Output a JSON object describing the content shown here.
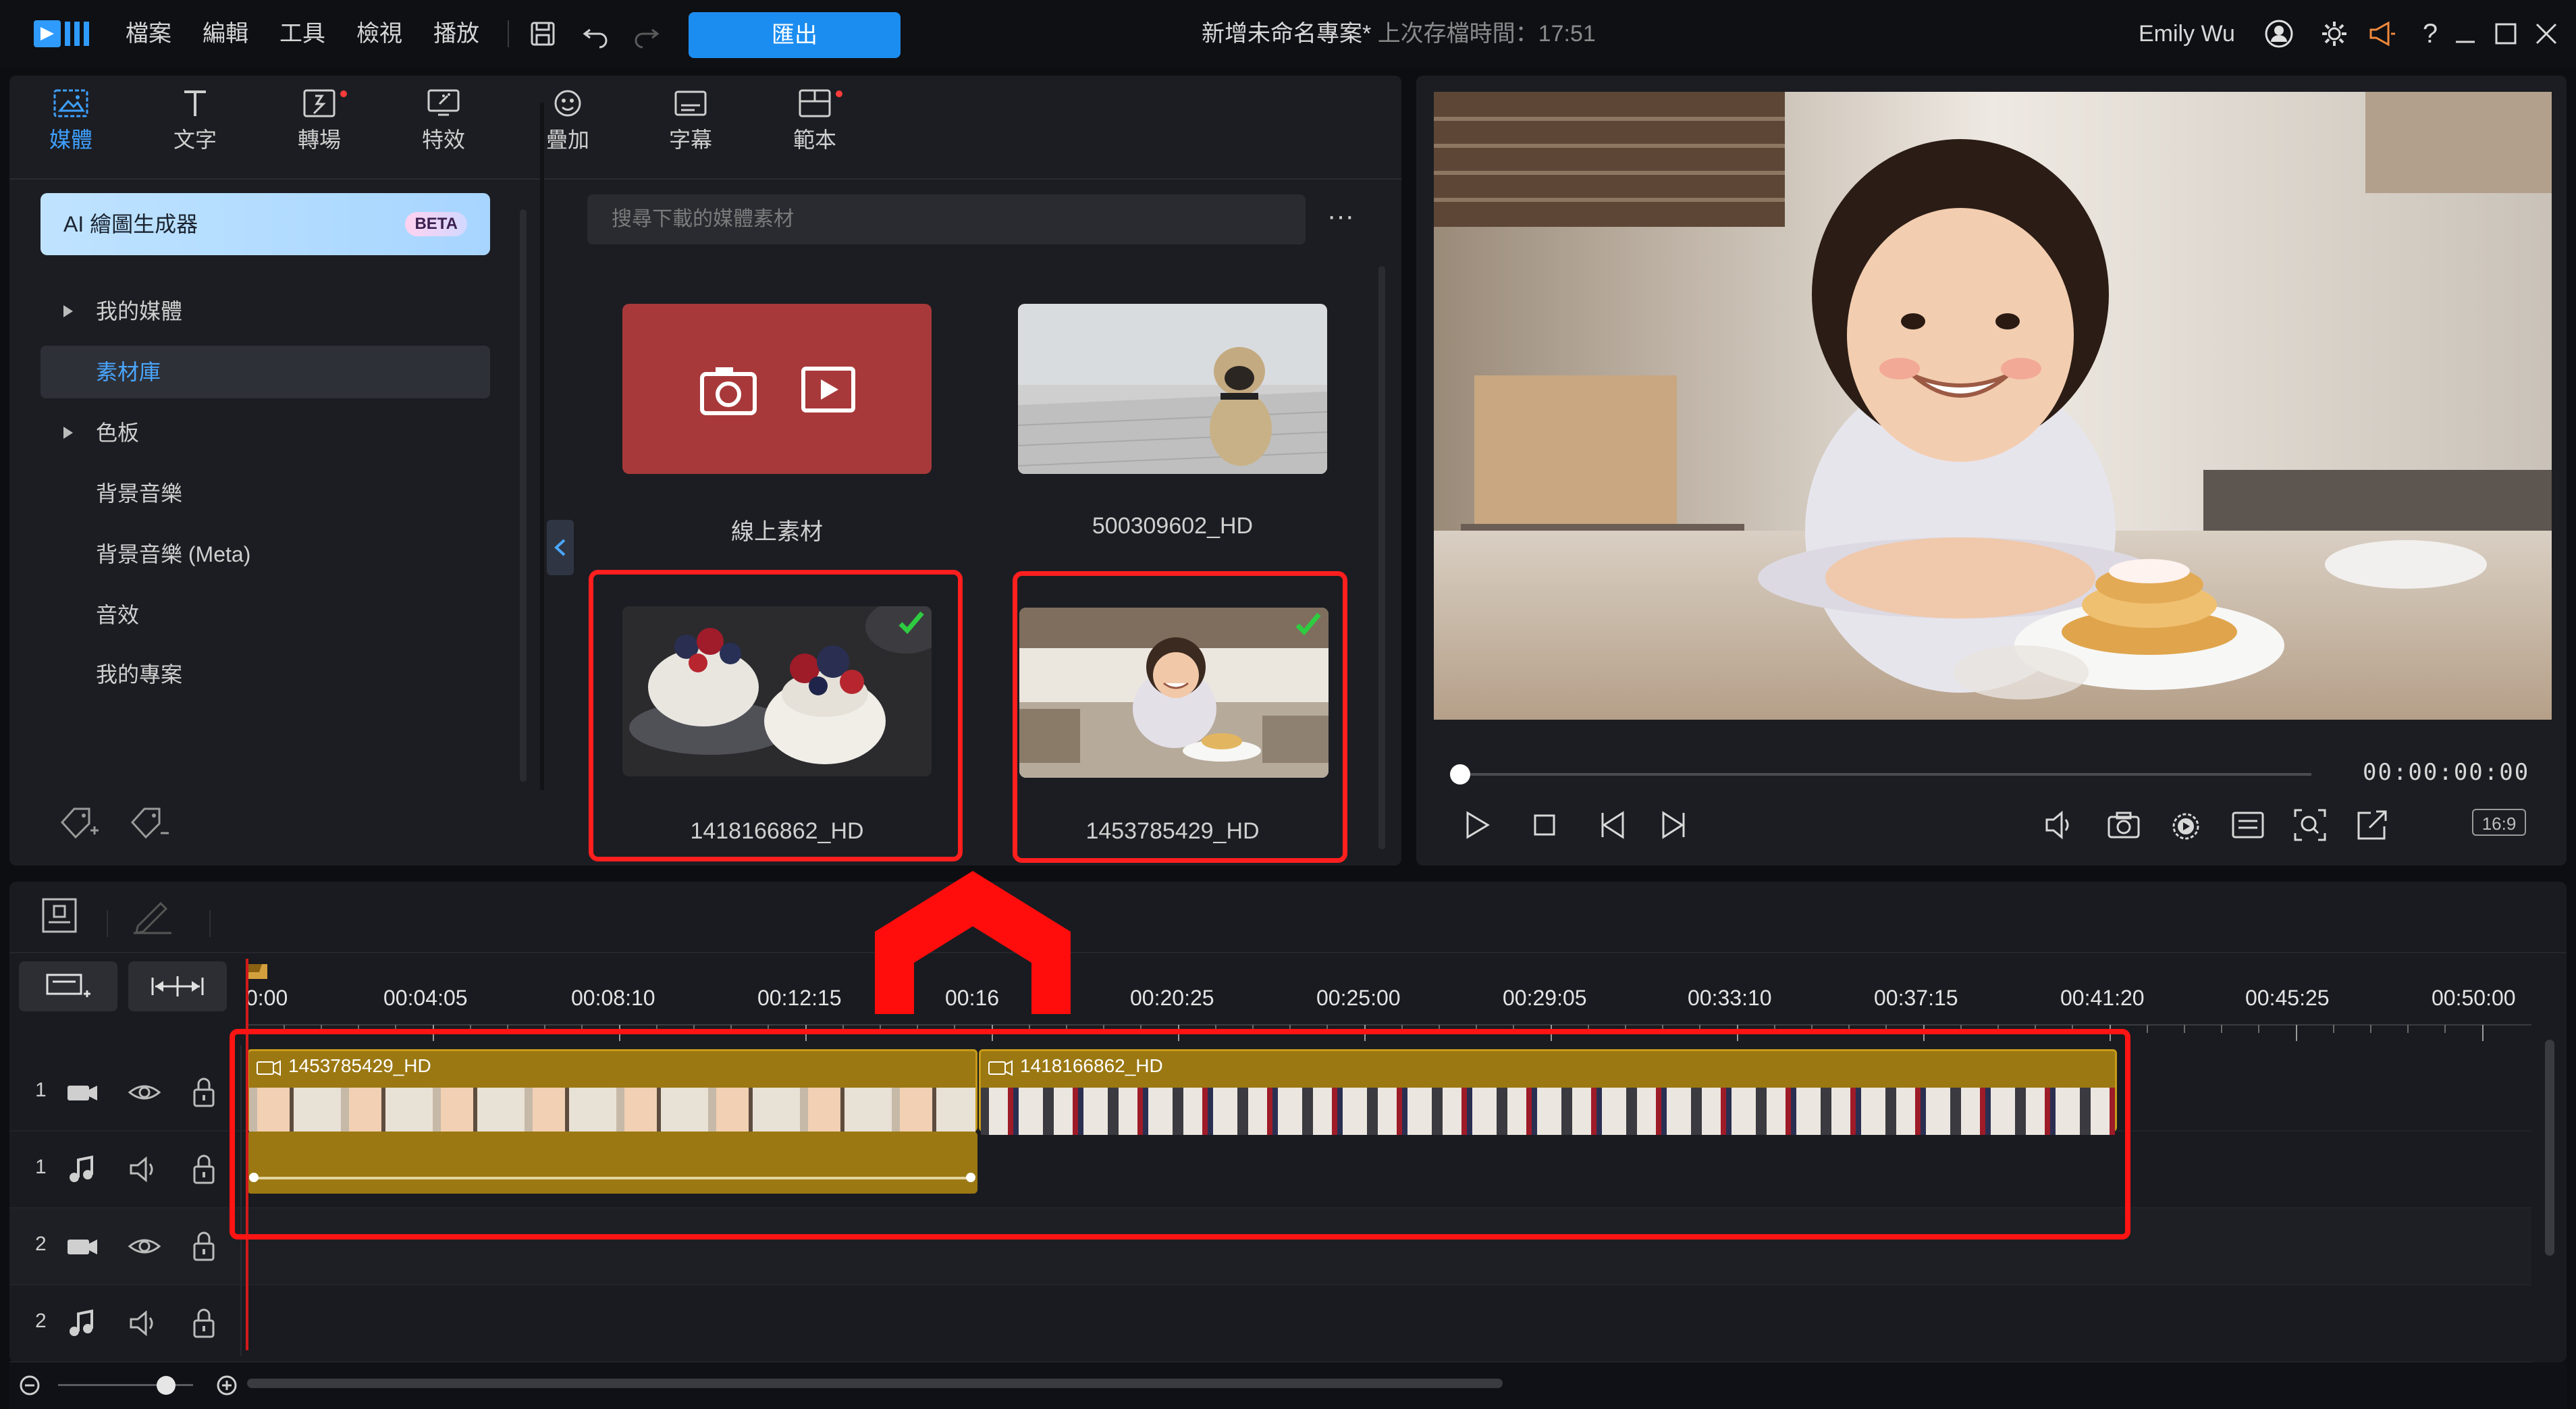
{
  "titlebar": {
    "menu": [
      "檔案",
      "編輯",
      "工具",
      "檢視",
      "播放"
    ],
    "export_label": "匯出",
    "project_title": "新增未命名專案*",
    "last_saved": "上次存檔時間：17:51",
    "user_name": "Emily Wu"
  },
  "tabs": [
    {
      "label": "媒體",
      "icon": "media-icon",
      "active": true
    },
    {
      "label": "文字",
      "icon": "text-icon"
    },
    {
      "label": "轉場",
      "icon": "transition-icon"
    },
    {
      "label": "特效",
      "icon": "effects-icon"
    },
    {
      "label": "疊加",
      "icon": "overlay-icon"
    },
    {
      "label": "字幕",
      "icon": "subtitle-icon"
    },
    {
      "label": "範本",
      "icon": "template-icon"
    }
  ],
  "sidebar": {
    "ai_label": "AI 繪圖生成器",
    "beta": "BETA",
    "items": [
      {
        "label": "我的媒體",
        "expandable": true
      },
      {
        "label": "素材庫",
        "active": true
      },
      {
        "label": "色板",
        "expandable": true
      },
      {
        "label": "背景音樂"
      },
      {
        "label": "背景音樂 (Meta)"
      },
      {
        "label": "音效"
      },
      {
        "label": "我的專案"
      }
    ]
  },
  "library": {
    "search_placeholder": "搜尋下載的媒體素材",
    "more": "···",
    "items": [
      {
        "label": "線上素材"
      },
      {
        "label": "500309602_HD"
      },
      {
        "label": "1418166862_HD",
        "selected": true
      },
      {
        "label": "1453785429_HD",
        "selected": true
      }
    ]
  },
  "preview": {
    "timecode": "00:00:00:00",
    "aspect_ratio": "16:9",
    "progress": 0
  },
  "timeline": {
    "ruler": [
      "0:00",
      "00:04:05",
      "00:08:10",
      "00:12:15",
      "00:16",
      "00:20:25",
      "00:25:00",
      "00:29:05",
      "00:33:10",
      "00:37:15",
      "00:41:20",
      "00:45:25",
      "00:50:00"
    ],
    "tracks": [
      {
        "number": "1",
        "kind": "video"
      },
      {
        "number": "1",
        "kind": "audio"
      },
      {
        "number": "2",
        "kind": "video"
      },
      {
        "number": "2",
        "kind": "audio"
      }
    ],
    "clips": [
      {
        "label": "1453785429_HD"
      },
      {
        "label": "1418166862_HD"
      }
    ]
  }
}
